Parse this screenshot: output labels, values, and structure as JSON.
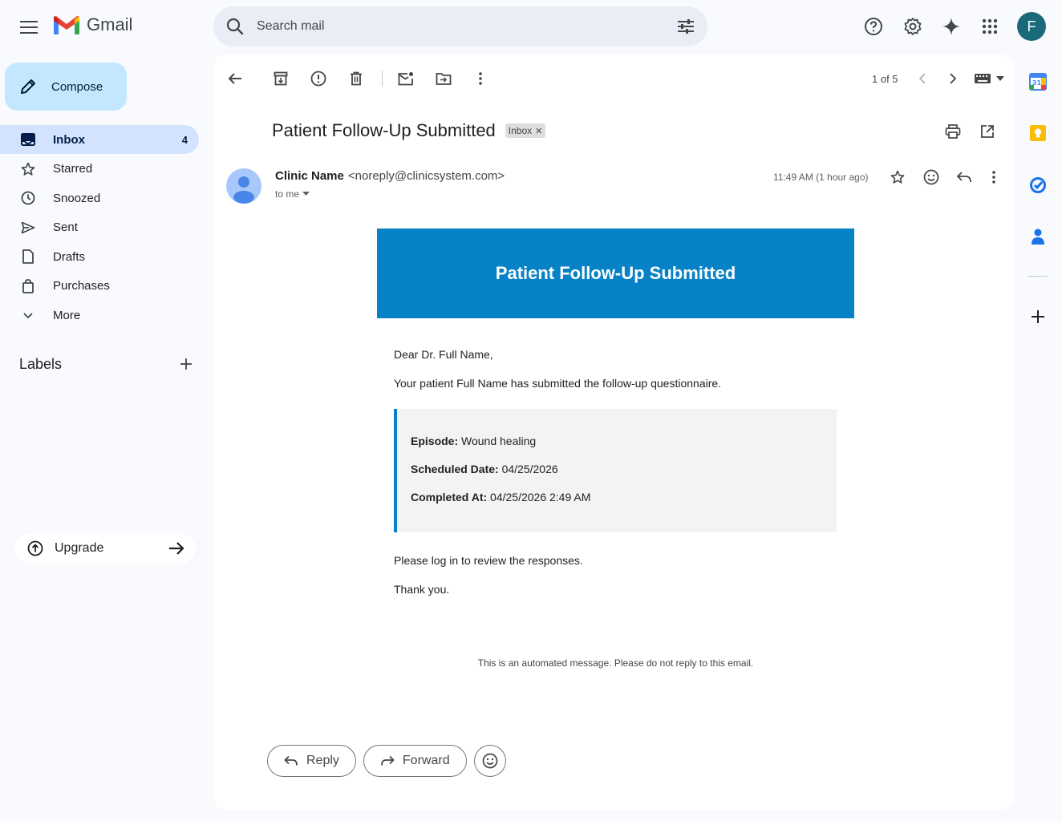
{
  "app": {
    "name": "Gmail",
    "account_initial": "F"
  },
  "search": {
    "placeholder": "Search mail"
  },
  "sidebar": {
    "compose_label": "Compose",
    "items": [
      {
        "label": "Inbox",
        "count": "4",
        "icon": "inbox-icon"
      },
      {
        "label": "Starred",
        "count": "",
        "icon": "star-icon"
      },
      {
        "label": "Snoozed",
        "count": "",
        "icon": "clock-icon"
      },
      {
        "label": "Sent",
        "count": "",
        "icon": "send-icon"
      },
      {
        "label": "Drafts",
        "count": "",
        "icon": "draft-icon"
      },
      {
        "label": "Purchases",
        "count": "",
        "icon": "shopping-bag-icon"
      },
      {
        "label": "More",
        "count": "",
        "icon": "chevron-down-icon"
      }
    ],
    "labels_title": "Labels",
    "upgrade_label": "Upgrade"
  },
  "toolbar": {
    "pager": "1 of 5"
  },
  "message": {
    "subject": "Patient Follow-Up Submitted",
    "label_chip": "Inbox",
    "sender_name": "Clinic Name",
    "sender_email": "<noreply@clinicsystem.com>",
    "recipient": "to me",
    "timestamp": "11:49 AM (1 hour ago)"
  },
  "email_body": {
    "banner_title": "Patient Follow-Up Submitted",
    "greeting": "Dear Dr. Full Name,",
    "intro": "Your patient Full Name has submitted the follow-up questionnaire.",
    "details": [
      {
        "label": "Episode:",
        "value": "Wound healing"
      },
      {
        "label": "Scheduled Date:",
        "value": "04/25/2026"
      },
      {
        "label": "Completed At:",
        "value": "04/25/2026 2:49 AM"
      }
    ],
    "instruction": "Please log in to review the responses.",
    "closing": "Thank you.",
    "footer": "This is an automated message. Please do not reply to this email."
  },
  "actions": {
    "reply_label": "Reply",
    "forward_label": "Forward"
  },
  "colors": {
    "banner": "#0782c6",
    "compose_bg": "#c2e7ff",
    "active_nav": "#d3e3fd"
  }
}
